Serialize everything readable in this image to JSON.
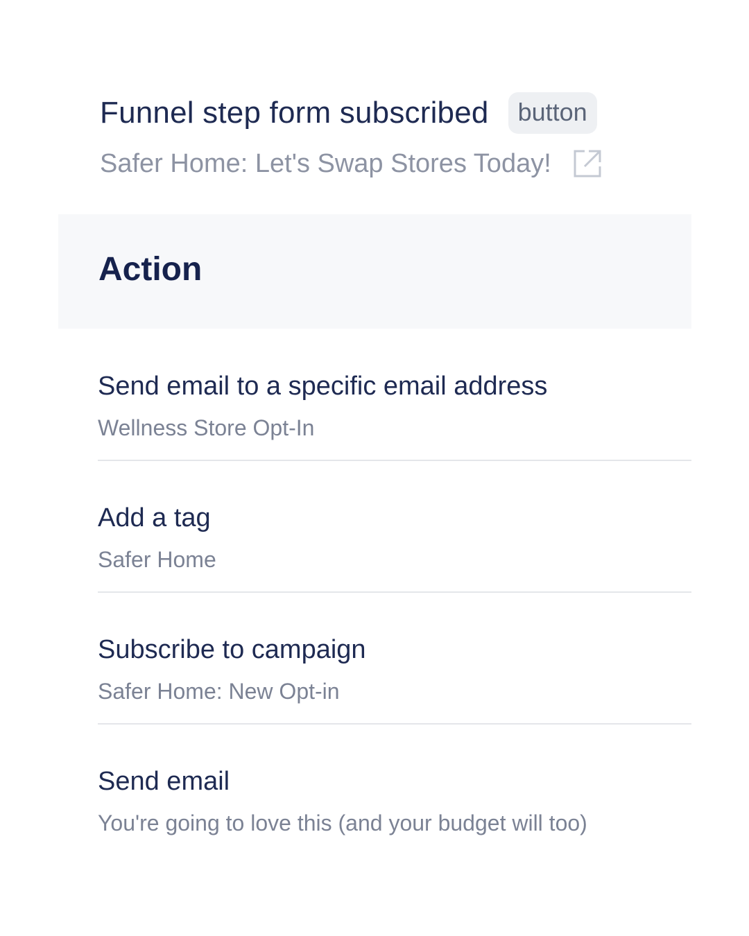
{
  "trigger": {
    "title": "Funnel step form subscribed",
    "badge": "button",
    "subtitle": "Safer Home: Let's Swap Stores Today!",
    "link_icon": "external-link-icon"
  },
  "section": {
    "title": "Action"
  },
  "actions": [
    {
      "label": "Send email to a specific email address",
      "detail": "Wellness Store Opt-In"
    },
    {
      "label": "Add a tag",
      "detail": "Safer Home"
    },
    {
      "label": "Subscribe to campaign",
      "detail": "Safer Home: New Opt-in"
    },
    {
      "label": "Send email",
      "detail": "You're going to love this (and your budget will too)"
    }
  ],
  "colors": {
    "title_text": "#1e2a52",
    "header_background": "#f7f8fa",
    "muted_text": "#8d93a3",
    "divider": "#e4e6ea"
  }
}
